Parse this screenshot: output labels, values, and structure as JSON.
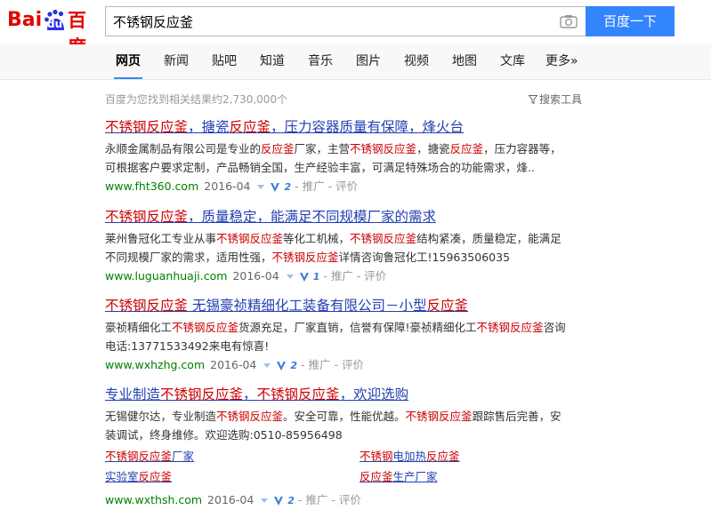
{
  "header": {
    "logo": {
      "bai": "Bai",
      "du": "du",
      "cn": "百度"
    },
    "search_value": "不锈钢反应釜",
    "search_button": "百度一下"
  },
  "nav": {
    "items": [
      "网页",
      "新闻",
      "贴吧",
      "知道",
      "音乐",
      "图片",
      "视频",
      "地图",
      "文库",
      "更多»"
    ],
    "active_index": 0
  },
  "meta": {
    "result_count": "百度为您找到相关结果约2,730,000个",
    "tools_label": "搜索工具"
  },
  "results": [
    {
      "title": [
        {
          "t": "不锈钢反应釜",
          "em": true
        },
        {
          "t": "，搪瓷",
          "em": false
        },
        {
          "t": "反应釜",
          "em": true
        },
        {
          "t": "，压力容器质量有保障，烽火台",
          "em": false
        }
      ],
      "abstract": [
        [
          {
            "t": "永顺金属制品有限公司是专业的",
            "em": false
          },
          {
            "t": "反应釜",
            "em": true
          },
          {
            "t": "厂家，主营",
            "em": false
          },
          {
            "t": "不锈钢反应釜",
            "em": true
          },
          {
            "t": "，搪瓷",
            "em": false
          },
          {
            "t": "反应釜",
            "em": true
          },
          {
            "t": "，压力容器等，",
            "em": false
          }
        ],
        [
          {
            "t": "可根据客户要求定制，产品畅销全国，生产经验丰富，可满足特殊场合的功能需求，烽..",
            "em": false
          }
        ]
      ],
      "url": "www.fht360.com",
      "date": "2016-04",
      "v": "2",
      "extra": "- 推广 - 评价"
    },
    {
      "title": [
        {
          "t": "不锈钢反应釜",
          "em": true
        },
        {
          "t": "，质量稳定，能满足不同规模厂家的需求",
          "em": false
        }
      ],
      "abstract": [
        [
          {
            "t": "莱州鲁冠化工专业从事",
            "em": false
          },
          {
            "t": "不锈钢反应釜",
            "em": true
          },
          {
            "t": "等化工机械，",
            "em": false
          },
          {
            "t": "不锈钢反应釜",
            "em": true
          },
          {
            "t": "结构紧凑，质量稳定，能满足",
            "em": false
          }
        ],
        [
          {
            "t": "不同规模厂家的需求，适用性强，",
            "em": false
          },
          {
            "t": "不锈钢反应釜",
            "em": true
          },
          {
            "t": "详情咨询鲁冠化工!15963506035",
            "em": false
          }
        ]
      ],
      "url": "www.luguanhuaji.com",
      "date": "2016-04",
      "v": "1",
      "extra": "- 推广 - 评价"
    },
    {
      "title": [
        {
          "t": "不锈钢反应釜",
          "em": true
        },
        {
          "t": " 无锡豪祯精细化工装备有限公司－小型",
          "em": false
        },
        {
          "t": "反应釜",
          "em": true
        }
      ],
      "abstract": [
        [
          {
            "t": "豪祯精细化工",
            "em": false
          },
          {
            "t": "不锈钢反应釜",
            "em": true
          },
          {
            "t": "货源充足，厂家直销，信誉有保障!豪祯精细化工",
            "em": false
          },
          {
            "t": "不锈钢反应釜",
            "em": true
          },
          {
            "t": "咨询",
            "em": false
          }
        ],
        [
          {
            "t": "电话:13771533492来电有惊喜!",
            "em": false
          }
        ]
      ],
      "url": "www.wxhzhg.com",
      "date": "2016-04",
      "v": "2",
      "extra": "- 推广 - 评价"
    },
    {
      "title": [
        {
          "t": "专业制造",
          "em": false
        },
        {
          "t": "不锈钢反应釜",
          "em": true
        },
        {
          "t": "，",
          "em": false
        },
        {
          "t": "不锈钢反应釜",
          "em": true
        },
        {
          "t": "，欢迎选购",
          "em": false
        }
      ],
      "abstract": [
        [
          {
            "t": "无锡健尔达，专业制造",
            "em": false
          },
          {
            "t": "不锈钢反应釜",
            "em": true
          },
          {
            "t": "。安全可靠，性能优越。",
            "em": false
          },
          {
            "t": "不锈钢反应釜",
            "em": true
          },
          {
            "t": "跟踪售后完善，安",
            "em": false
          }
        ],
        [
          {
            "t": "装调试，终身维修。欢迎选购:0510-85956498",
            "em": false
          }
        ]
      ],
      "sublinks": [
        [
          {
            "t": "不锈钢反应釜",
            "em": true
          },
          {
            "t": "厂家",
            "em": false
          }
        ],
        [
          {
            "t": "不锈钢",
            "em": true
          },
          {
            "t": "电加热",
            "em": false
          },
          {
            "t": "反应釜",
            "em": true
          }
        ],
        [
          {
            "t": "实验室",
            "em": false
          },
          {
            "t": "反应釜",
            "em": true
          }
        ],
        [
          {
            "t": "反应釜",
            "em": true
          },
          {
            "t": "生产厂家",
            "em": false
          }
        ]
      ],
      "url": "www.wxthsh.com",
      "date": "2016-04",
      "v": "2",
      "extra": "- 推广 - 评价"
    }
  ],
  "colors": {
    "accent": "#3385ff",
    "link": "#2440b3",
    "highlight": "#cc0000",
    "url": "#008000",
    "logo_red": "#e10601",
    "logo_blue": "#2932e1"
  }
}
